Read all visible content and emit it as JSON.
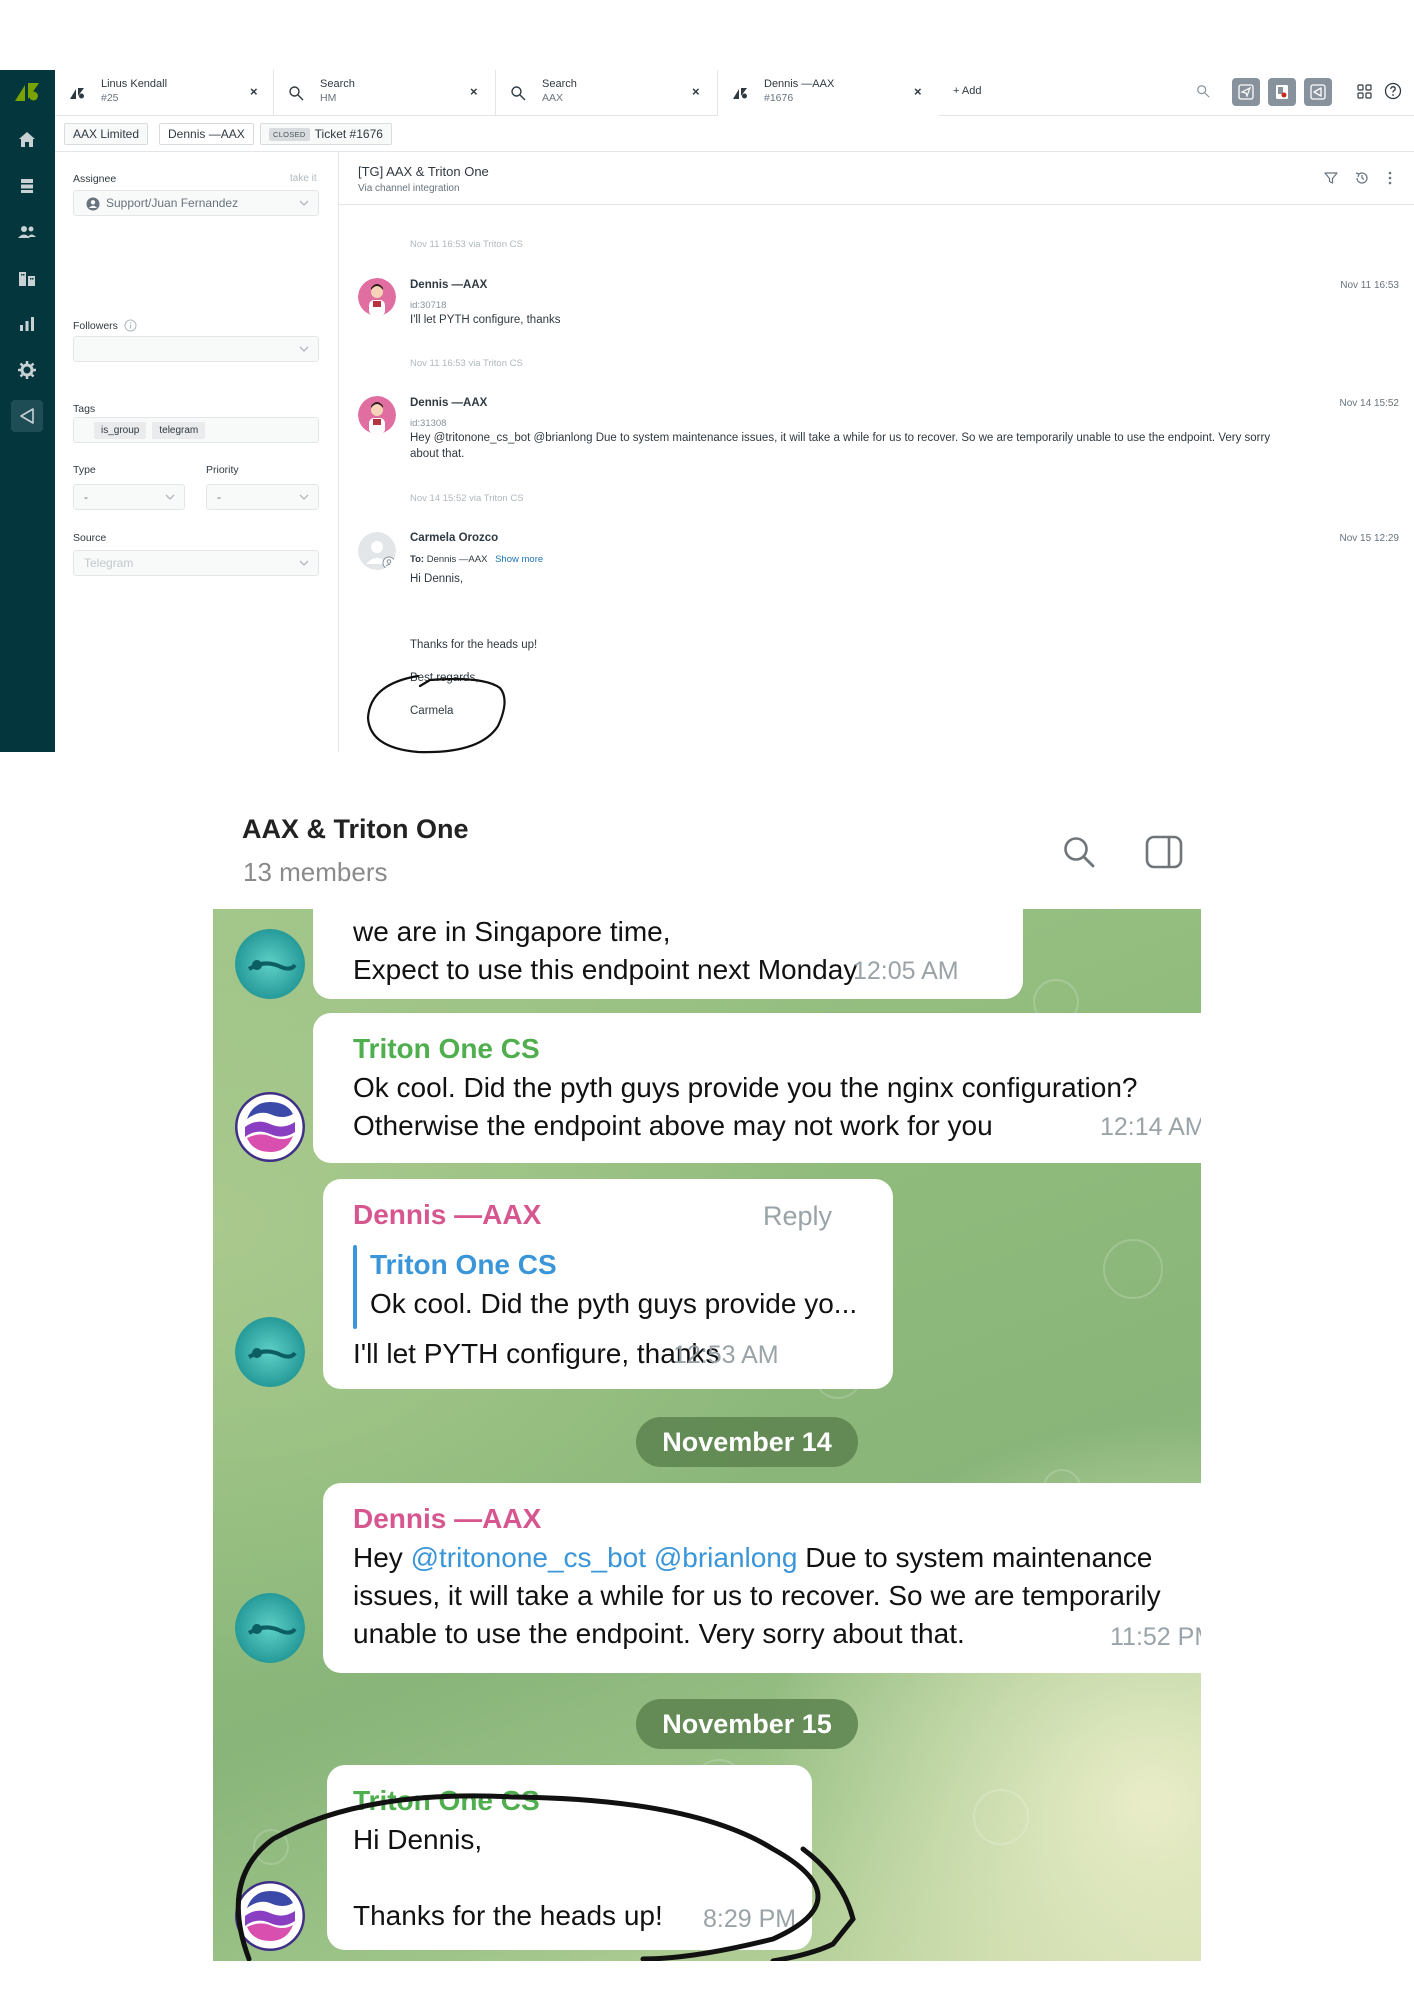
{
  "helpdesk": {
    "tabs": [
      {
        "title": "Linus Kendall",
        "sub": "#25",
        "icon": "ticket-icon"
      },
      {
        "title": "Search",
        "sub": "HM",
        "icon": "search-icon"
      },
      {
        "title": "Search",
        "sub": "AAX",
        "icon": "search-icon"
      },
      {
        "title": "Dennis —AAX",
        "sub": "#1676",
        "icon": "ticket-icon"
      }
    ],
    "tab_close": "×",
    "add_tab": "+ Add",
    "breadcrumbs": {
      "org": "AAX Limited",
      "requester": "Dennis —AAX",
      "status": "CLOSED",
      "ticket": "Ticket #1676"
    },
    "sidebar": {
      "assignee_label": "Assignee",
      "take_it": "take it",
      "assignee_value": "Support/Juan Fernandez",
      "followers_label": "Followers",
      "tags_label": "Tags",
      "tags": [
        "is_group",
        "telegram"
      ],
      "type_label": "Type",
      "type_value": "-",
      "priority_label": "Priority",
      "priority_value": "-",
      "source_label": "Source",
      "source_value": "Telegram"
    },
    "conversation": {
      "title": "[TG] AAX & Triton One",
      "subtitle": "Via channel integration",
      "first_via": "Nov 11 16:53 via Triton CS",
      "messages": [
        {
          "author": "Dennis —AAX",
          "date": "Nov 11 16:53",
          "id": "id:30718",
          "text": "I'll let PYTH configure,  thanks",
          "via": "Nov 11 16:53 via Triton CS"
        },
        {
          "author": "Dennis —AAX",
          "date": "Nov 14 15:52",
          "id": "id:31308",
          "text_line1": "Hey @tritonone_cs_bot @brianlong Due to system maintenance issues, it will take a while for us to recover. So we are temporarily unable to use the endpoint. Very sorry",
          "text_line2": "about that.",
          "via": "Nov 14 15:52 via Triton CS"
        },
        {
          "author": "Carmela Orozco",
          "date": "Nov 15 12:29",
          "to_label": "To:",
          "to_value": "Dennis —AAX",
          "show_more": "Show more",
          "greeting": "Hi Dennis,",
          "body": "Thanks for the heads up!",
          "signoff": "Best regards,",
          "signature": "Carmela"
        }
      ]
    }
  },
  "telegram": {
    "title": "AAX & Triton One",
    "members": "13 members",
    "messages": [
      {
        "line1": "we are in Singapore time,",
        "line2": "Expect to use this endpoint next Monday",
        "time": "12:05 AM"
      },
      {
        "name": "Triton One CS",
        "line1": "Ok cool. Did the pyth guys provide you the nginx configuration?",
        "line2": "Otherwise the endpoint above may not work for you",
        "time": "12:14 AM"
      },
      {
        "name": "Dennis —AAX",
        "reply_label": "Reply",
        "quote_name": "Triton One CS",
        "quote_text": "Ok cool. Did the pyth guys provide yo...",
        "text": "I'll let PYTH configure,   thanks",
        "time": "12:53 AM"
      },
      {
        "name": "Dennis —AAX",
        "mention1": "@tritonone_cs_bot",
        "mention2": "@brianlong",
        "line1_prefix": "Hey",
        "line1_suffix": "Due to system maintenance",
        "line2": "issues, it will take a while for us to recover. So we are temporarily",
        "line3": "unable to use the endpoint. Very sorry about that.",
        "time": "11:52 PM"
      },
      {
        "name": "Triton One CS",
        "line1": "Hi Dennis,",
        "line2": "Thanks for the heads up!",
        "time": "8:29 PM"
      }
    ],
    "date_separators": [
      "November 14",
      "November 15"
    ]
  },
  "colors": {
    "rail": "#03363d",
    "link": "#1f73b7",
    "tg_green_name": "#4fae4e",
    "tg_pink_name": "#d6568f",
    "tg_blue_name": "#3a96d9",
    "annotation": "#111111"
  }
}
